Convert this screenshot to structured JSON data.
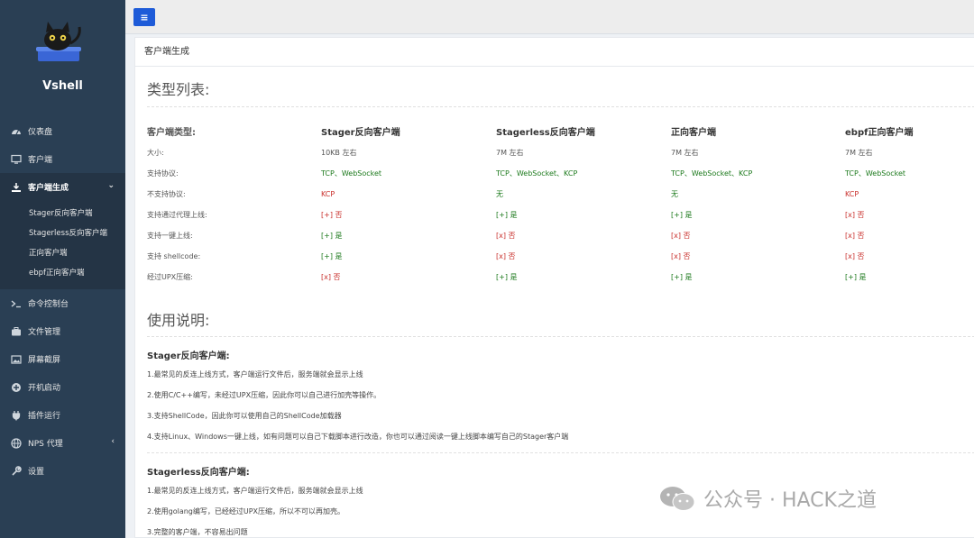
{
  "brand": {
    "name": "Vshell"
  },
  "sidebar": {
    "items": [
      {
        "label": "仪表盘",
        "icon": "dashboard-icon"
      },
      {
        "label": "客户端",
        "icon": "monitor-icon"
      },
      {
        "label": "客户端生成",
        "icon": "download-icon",
        "active": true
      },
      {
        "label": "命令控制台",
        "icon": "terminal-icon"
      },
      {
        "label": "文件管理",
        "icon": "briefcase-icon"
      },
      {
        "label": "屏幕截屏",
        "icon": "image-icon"
      },
      {
        "label": "开机启动",
        "icon": "plus-circle-icon"
      },
      {
        "label": "插件运行",
        "icon": "plug-icon"
      },
      {
        "label": "NPS 代理",
        "icon": "globe-icon"
      },
      {
        "label": "设置",
        "icon": "wrench-icon"
      }
    ],
    "submenu": [
      "Stager反向客户端",
      "Stagerless反向客户端",
      "正向客户端",
      "ebpf正向客户端"
    ]
  },
  "topbar": {
    "toggle_glyph": "≡"
  },
  "panel": {
    "title": "客户端生成",
    "types_heading": "类型列表:",
    "usage_heading": "使用说明:"
  },
  "types_table": {
    "headers": [
      "客户端类型:",
      "Stager反向客户端",
      "Stagerless反向客户端",
      "正向客户端",
      "ebpf正向客户端"
    ],
    "rows": [
      {
        "label": "大小:",
        "cells": [
          {
            "t": "10KB 左右",
            "c": "plain"
          },
          {
            "t": "7M 左右",
            "c": "plain"
          },
          {
            "t": "7M 左右",
            "c": "plain"
          },
          {
            "t": "7M 左右",
            "c": "plain"
          }
        ]
      },
      {
        "label": "支持协议:",
        "cells": [
          {
            "t": "TCP、WebSocket",
            "c": "green"
          },
          {
            "t": "TCP、WebSocket、KCP",
            "c": "green"
          },
          {
            "t": "TCP、WebSocket、KCP",
            "c": "green"
          },
          {
            "t": "TCP、WebSocket",
            "c": "green"
          }
        ]
      },
      {
        "label": "不支持协议:",
        "cells": [
          {
            "t": "KCP",
            "c": "red"
          },
          {
            "t": "无",
            "c": "green"
          },
          {
            "t": "无",
            "c": "green"
          },
          {
            "t": "KCP",
            "c": "red"
          }
        ]
      },
      {
        "label": "支持通过代理上线:",
        "cells": [
          {
            "t": "[+] 否",
            "c": "red"
          },
          {
            "t": "[+] 是",
            "c": "green"
          },
          {
            "t": "[+] 是",
            "c": "green"
          },
          {
            "t": "[x] 否",
            "c": "red"
          }
        ]
      },
      {
        "label": "支持一键上线:",
        "cells": [
          {
            "t": "[+] 是",
            "c": "green"
          },
          {
            "t": "[x] 否",
            "c": "red"
          },
          {
            "t": "[x] 否",
            "c": "red"
          },
          {
            "t": "[x] 否",
            "c": "red"
          }
        ]
      },
      {
        "label": "支持 shellcode:",
        "cells": [
          {
            "t": "[+] 是",
            "c": "green"
          },
          {
            "t": "[x] 否",
            "c": "red"
          },
          {
            "t": "[x] 否",
            "c": "red"
          },
          {
            "t": "[x] 否",
            "c": "red"
          }
        ]
      },
      {
        "label": "经过UPX压缩:",
        "cells": [
          {
            "t": "[x] 否",
            "c": "red"
          },
          {
            "t": "[+] 是",
            "c": "green"
          },
          {
            "t": "[+] 是",
            "c": "green"
          },
          {
            "t": "[+] 是",
            "c": "green"
          }
        ]
      }
    ]
  },
  "usage": [
    {
      "heading": "Stager反向客户端:",
      "lines": [
        "1.最常见的反连上线方式，客户端运行文件后，服务端就会显示上线",
        "2.使用C/C++编写，未经过UPX压缩，因此你可以自己进行加壳等操作。",
        "3.支持ShellCode，因此你可以使用自己的ShellCode加载器",
        "4.支持Linux、Windows一键上线，如有问题可以自己下载脚本进行改造，你也可以通过阅读一键上线脚本编写自己的Stager客户端"
      ]
    },
    {
      "heading": "Stagerless反向客户端:",
      "lines": [
        "1.最常见的反连上线方式，客户端运行文件后，服务端就会显示上线",
        "2.使用golang编写，已经经过UPX压缩，所以不可以再加壳。",
        "3.完整的客户端，不容易出问题"
      ]
    }
  ],
  "watermark": {
    "text": "公众号 · HACK之道"
  }
}
